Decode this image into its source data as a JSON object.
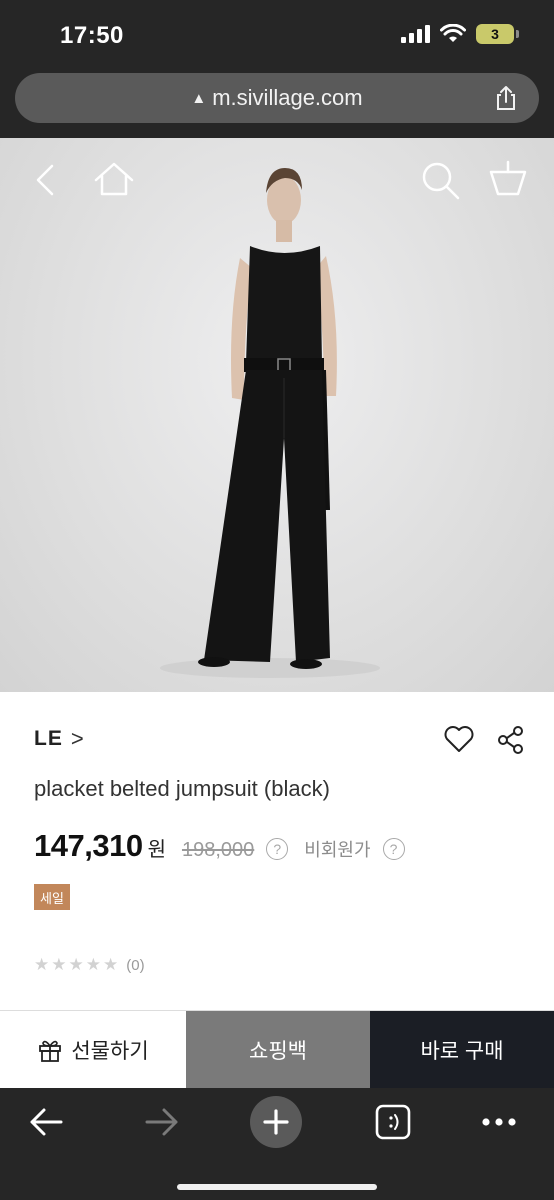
{
  "status": {
    "time": "17:50",
    "battery": "3"
  },
  "browser": {
    "url": "m.sivillage.com"
  },
  "hero": {
    "icons": [
      "back-icon",
      "home-icon",
      "search-icon",
      "cart-icon"
    ]
  },
  "product": {
    "brand": "LE",
    "brand_chevron": ">",
    "title": "placket belted jumpsuit (black)",
    "price": "147,310",
    "price_unit": "원",
    "original_price": "198,000",
    "help_mark": "?",
    "member_price_label": "비회원가",
    "sale_badge": "세일",
    "rating_stars": 0,
    "review_count": "(0)"
  },
  "actions": {
    "gift_label": "선물하기",
    "cart_label": "쇼핑백",
    "buy_label": "바로 구매"
  },
  "colors": {
    "chrome": "#262626",
    "sale_badge": "#c2875a",
    "cart_button": "#7a7a7a",
    "buy_button": "#1b1e25"
  }
}
